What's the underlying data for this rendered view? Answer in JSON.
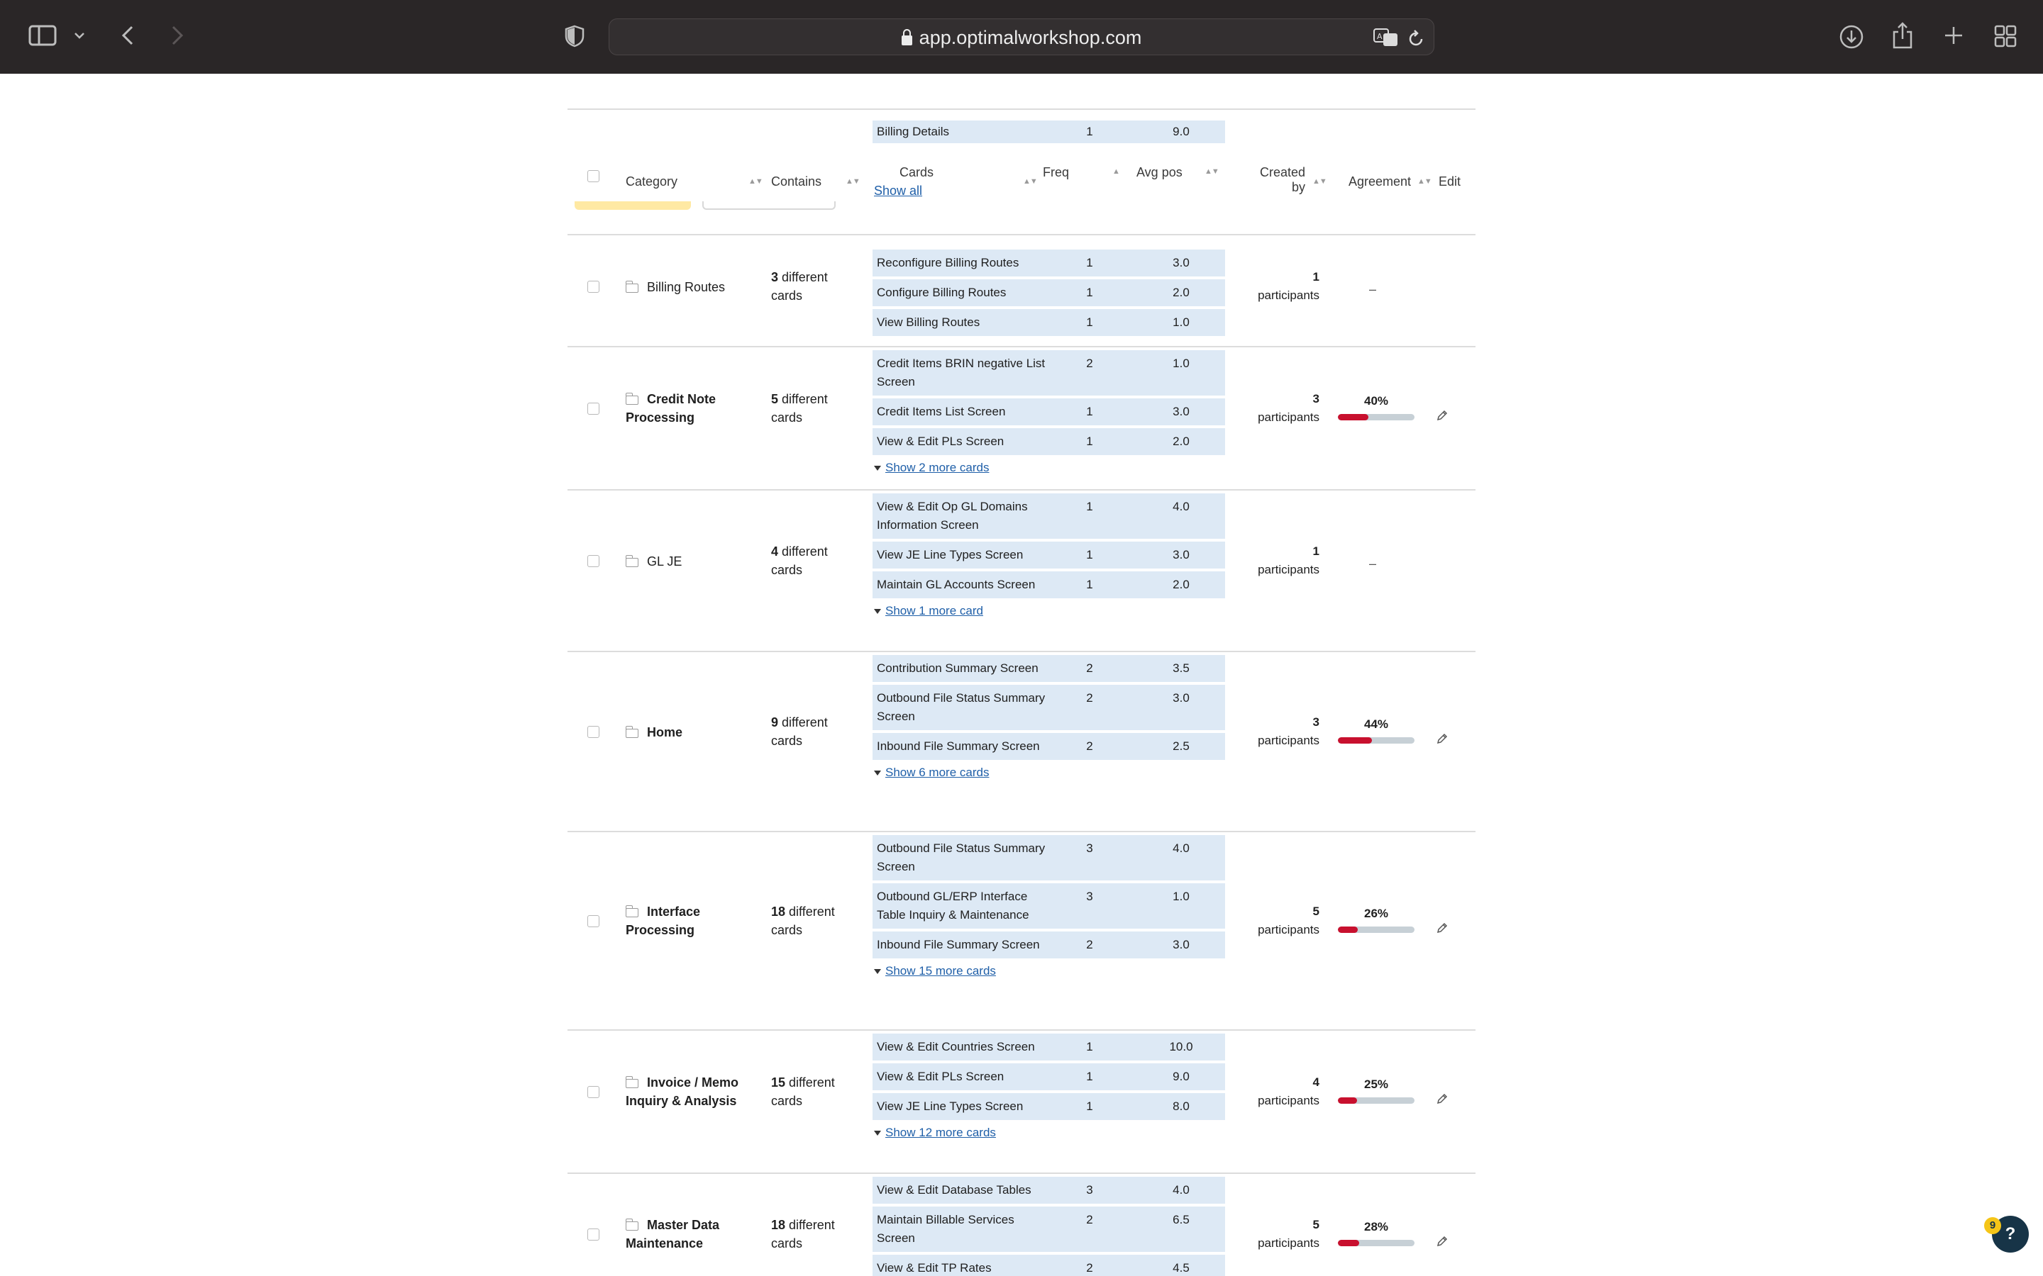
{
  "browser": {
    "url": "app.optimalworkshop.com"
  },
  "header": {
    "category": "Category",
    "contains": "Contains",
    "cards": "Cards",
    "show_all": "Show all",
    "freq": "Freq",
    "avg_pos": "Avg pos",
    "created_by_1": "Created",
    "created_by_2": "by",
    "agreement": "Agreement",
    "edit": "Edit"
  },
  "prev_row": {
    "card": "Billing Details",
    "freq": "1",
    "avg": "9.0"
  },
  "rows": [
    {
      "category": "Billing Routes",
      "bold": false,
      "count": "3",
      "count_suffix": " different cards",
      "cards": [
        {
          "name": "Reconfigure Billing Routes",
          "freq": "1",
          "avg": "3.0"
        },
        {
          "name": "Configure Billing Routes",
          "freq": "1",
          "avg": "2.0"
        },
        {
          "name": "View Billing Routes",
          "freq": "1",
          "avg": "1.0"
        }
      ],
      "more": "",
      "participants": "1",
      "participants_label": "participants",
      "agreement": "",
      "agreement_value": null,
      "dash": "–"
    },
    {
      "category": "Credit Note Processing",
      "bold": true,
      "count": "5",
      "count_suffix": " different cards",
      "cards": [
        {
          "name": "Credit Items BRIN negative List Screen",
          "freq": "2",
          "avg": "1.0"
        },
        {
          "name": "Credit Items List Screen",
          "freq": "1",
          "avg": "3.0"
        },
        {
          "name": "View & Edit PLs Screen",
          "freq": "1",
          "avg": "2.0"
        }
      ],
      "more": "Show 2 more cards",
      "participants": "3",
      "participants_label": "participants",
      "agreement": "40%",
      "agreement_value": 0.4,
      "dash": ""
    },
    {
      "category": "GL JE",
      "bold": false,
      "count": "4",
      "count_suffix": " different cards",
      "cards": [
        {
          "name": "View & Edit Op GL Domains Information Screen",
          "freq": "1",
          "avg": "4.0"
        },
        {
          "name": "View JE Line Types Screen",
          "freq": "1",
          "avg": "3.0"
        },
        {
          "name": "Maintain GL Accounts Screen",
          "freq": "1",
          "avg": "2.0"
        }
      ],
      "more": "Show 1 more card",
      "participants": "1",
      "participants_label": "participants",
      "agreement": "",
      "agreement_value": null,
      "dash": "–"
    },
    {
      "category": "Home",
      "bold": true,
      "count": "9",
      "count_suffix": " different cards",
      "cards": [
        {
          "name": "Contribution Summary Screen",
          "freq": "2",
          "avg": "3.5"
        },
        {
          "name": "Outbound File Status Summary Screen",
          "freq": "2",
          "avg": "3.0"
        },
        {
          "name": "Inbound File Summary Screen",
          "freq": "2",
          "avg": "2.5"
        }
      ],
      "more": "Show 6 more cards",
      "participants": "3",
      "participants_label": "participants",
      "agreement": "44%",
      "agreement_value": 0.44,
      "dash": ""
    },
    {
      "category": "Interface Processing",
      "bold": true,
      "count": "18",
      "count_suffix": " different cards",
      "cards": [
        {
          "name": "Outbound File Status Summary Screen",
          "freq": "3",
          "avg": "4.0"
        },
        {
          "name": "Outbound GL/ERP Interface Table Inquiry & Maintenance",
          "freq": "3",
          "avg": "1.0"
        },
        {
          "name": "Inbound File Summary Screen",
          "freq": "2",
          "avg": "3.0"
        }
      ],
      "more": "Show 15 more cards",
      "participants": "5",
      "participants_label": "participants",
      "agreement": "26%",
      "agreement_value": 0.26,
      "dash": ""
    },
    {
      "category": "Invoice / Memo Inquiry & Analysis",
      "bold": true,
      "count": "15",
      "count_suffix": " different cards",
      "cards": [
        {
          "name": "View & Edit Countries Screen",
          "freq": "1",
          "avg": "10.0"
        },
        {
          "name": "View & Edit PLs Screen",
          "freq": "1",
          "avg": "9.0"
        },
        {
          "name": "View JE Line Types Screen",
          "freq": "1",
          "avg": "8.0"
        }
      ],
      "more": "Show 12 more cards",
      "participants": "4",
      "participants_label": "participants",
      "agreement": "25%",
      "agreement_value": 0.25,
      "dash": ""
    },
    {
      "category": "Master Data Maintenance",
      "bold": true,
      "count": "18",
      "count_suffix": " different cards",
      "cards": [
        {
          "name": "View & Edit Database Tables",
          "freq": "3",
          "avg": "4.0"
        },
        {
          "name": "Maintain Billable Services Screen",
          "freq": "2",
          "avg": "6.5"
        },
        {
          "name": "View & Edit TP Rates",
          "freq": "2",
          "avg": "4.5"
        }
      ],
      "more": "",
      "participants": "5",
      "participants_label": "participants",
      "agreement": "28%",
      "agreement_value": 0.28,
      "dash": ""
    }
  ],
  "help": {
    "label": "?",
    "badge": "9"
  },
  "colors": {
    "card_bg": "#dde9f5",
    "bar_fill": "#c8102e",
    "bar_track": "#c7d0d6",
    "link": "#1f5fa8"
  }
}
